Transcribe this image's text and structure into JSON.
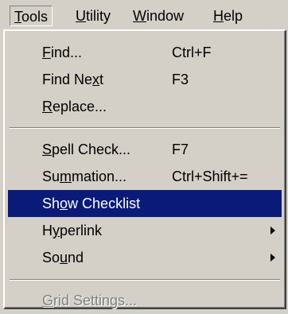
{
  "menubar": {
    "tools": {
      "pre": "",
      "u": "T",
      "post": "ools"
    },
    "utility": {
      "pre": "",
      "u": "U",
      "post": "tility"
    },
    "window": {
      "pre": "",
      "u": "W",
      "post": "indow"
    },
    "help": {
      "pre": "",
      "u": "H",
      "post": "elp"
    }
  },
  "tools_menu": {
    "find": {
      "pre": "",
      "u": "F",
      "post": "ind...",
      "shortcut": "Ctrl+F"
    },
    "find_next": {
      "pre": "Find Ne",
      "u": "x",
      "post": "t",
      "shortcut": "F3"
    },
    "replace": {
      "pre": "",
      "u": "R",
      "post": "eplace..."
    },
    "spell_check": {
      "pre": "",
      "u": "S",
      "post": "pell Check...",
      "shortcut": "F7"
    },
    "summation": {
      "pre": "Su",
      "u": "m",
      "post": "mation...",
      "shortcut": "Ctrl+Shift+="
    },
    "show_checklist": {
      "pre": "Sh",
      "u": "o",
      "post": "w Checklist"
    },
    "hyperlink": {
      "pre": "H",
      "u": "y",
      "post": "perlink"
    },
    "sound": {
      "pre": "So",
      "u": "u",
      "post": "nd"
    },
    "grid_settings": {
      "pre": "",
      "u": "G",
      "post": "rid Settings..."
    }
  },
  "colors": {
    "menu_bg": "#d4d0c8",
    "highlight_bg": "#0a1a78",
    "highlight_text": "#ffffff",
    "disabled_text": "#808080"
  },
  "icons": {
    "submenu_arrow": "submenu-arrow-icon"
  }
}
